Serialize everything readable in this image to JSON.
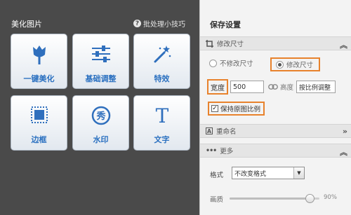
{
  "left_panel": {
    "title": "美化图片",
    "batch_tips": "批处理小技巧",
    "tools": [
      {
        "label": "一键美化",
        "icon": "tulip-icon"
      },
      {
        "label": "基础调整",
        "icon": "sliders-icon"
      },
      {
        "label": "特效",
        "icon": "magic-wand-icon"
      },
      {
        "label": "边框",
        "icon": "frame-icon"
      },
      {
        "label": "水印",
        "icon": "watermark-seal-icon"
      },
      {
        "label": "文字",
        "icon": "text-t-icon"
      }
    ]
  },
  "right_panel": {
    "title": "保存设置",
    "resize_section": {
      "title": "修改尺寸",
      "option_no_resize": "不修改尺寸",
      "option_resize": "修改尺寸",
      "selected": "修改尺寸",
      "width_label": "宽度",
      "width_value": "500",
      "height_label": "高度",
      "height_value": "按比例调整",
      "keep_ratio_label": "保持原图比例",
      "keep_ratio_checked": true
    },
    "rename_section": {
      "title": "重命名"
    },
    "more_section": {
      "title": "更多",
      "format_label": "格式",
      "format_value": "不改变格式",
      "quality_label": "画质",
      "quality_value": "90%",
      "quality_fraction": 0.9
    }
  },
  "colors": {
    "accent_orange": "#e8822c",
    "tile_label_blue": "#2a70c0",
    "icon_blue": "#2f6fbd"
  }
}
